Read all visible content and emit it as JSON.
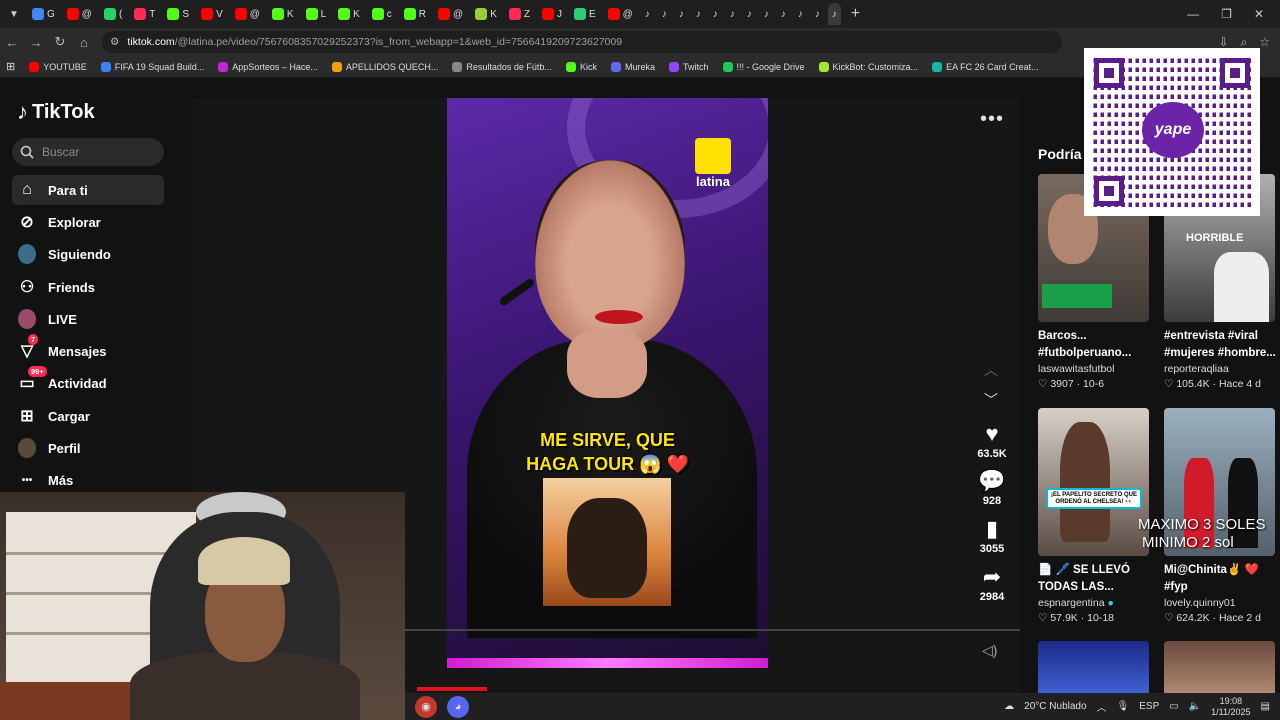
{
  "browser": {
    "tabs": [
      {
        "label": "G",
        "color": "#4285f4"
      },
      {
        "label": "@",
        "color": "#ff0000"
      },
      {
        "label": "(",
        "color": "#25d366"
      },
      {
        "label": "T",
        "color": "#fe2c55"
      },
      {
        "label": "S",
        "color": "#53fc18"
      },
      {
        "label": "V",
        "color": "#ff0000"
      },
      {
        "label": "@",
        "color": "#ff0000"
      },
      {
        "label": "K",
        "color": "#53fc18"
      },
      {
        "label": "L",
        "color": "#53fc18"
      },
      {
        "label": "K",
        "color": "#53fc18"
      },
      {
        "label": "c",
        "color": "#53fc18"
      },
      {
        "label": "R",
        "color": "#53fc18"
      },
      {
        "label": "@",
        "color": "#ff0000"
      },
      {
        "label": "K",
        "color": "#9acd32"
      },
      {
        "label": "Z",
        "color": "#fe2c55"
      },
      {
        "label": "J",
        "color": "#ff0000"
      },
      {
        "label": "E",
        "color": "#2ecc71"
      },
      {
        "label": "@",
        "color": "#ff0000"
      }
    ],
    "new_tab": "+",
    "url_host": "tiktok.com",
    "url_path": "/@latina.pe/video/7567608357029252373?is_from_webapp=1&web_id=7566419209723627009",
    "bookmarks": [
      {
        "label": "YOUTUBE",
        "color": "#ff0000"
      },
      {
        "label": "FIFA 19 Squad Build...",
        "color": "#3b82f6"
      },
      {
        "label": "AppSorteos – Hace...",
        "color": "#c026d3"
      },
      {
        "label": "APELLIDOS QUECH...",
        "color": "#f59e0b"
      },
      {
        "label": "Resultados de Fútb...",
        "color": "#888888"
      },
      {
        "label": "Kick",
        "color": "#53fc18"
      },
      {
        "label": "Mureka",
        "color": "#6366f1"
      },
      {
        "label": "Twitch",
        "color": "#9146ff"
      },
      {
        "label": "!!! - Google Drive",
        "color": "#22c55e"
      },
      {
        "label": "KickBot: Customiza...",
        "color": "#a3e635"
      },
      {
        "label": "EA FC 26 Card Creat...",
        "color": "#14b8a6"
      }
    ]
  },
  "sidebar": {
    "logo": "TikTok",
    "search_placeholder": "Buscar",
    "items": [
      {
        "label": "Para ti",
        "icon": "home-icon",
        "active": true
      },
      {
        "label": "Explorar",
        "icon": "compass-icon"
      },
      {
        "label": "Siguiendo",
        "icon": "avatar-icon"
      },
      {
        "label": "Friends",
        "icon": "friends-icon"
      },
      {
        "label": "LIVE",
        "icon": "live-avatar-icon"
      },
      {
        "label": "Mensajes",
        "icon": "send-icon",
        "badge": "7"
      },
      {
        "label": "Actividad",
        "icon": "inbox-icon",
        "badge": "99+"
      },
      {
        "label": "Cargar",
        "icon": "upload-icon"
      },
      {
        "label": "Perfil",
        "icon": "profile-avatar-icon"
      },
      {
        "label": "Más",
        "icon": "more-icon"
      }
    ]
  },
  "video": {
    "channel_logo": "latina",
    "caption_line1": "ME SIRVE, QUE",
    "caption_line2": "HAGA TOUR 😱 ❤️",
    "likes": "63.5K",
    "comments": "928",
    "saves": "3055",
    "shares": "2984"
  },
  "suggestions": {
    "heading": "Podría",
    "cards": [
      {
        "title": "Barcos...",
        "title2": "#futbolperuano...",
        "user": "laswawitasfutbol",
        "likes": "3907",
        "date": "10-6",
        "overlay": "",
        "verified": false
      },
      {
        "title": "#entrevista #viral",
        "title2": "#mujeres #hombre...",
        "user": "reporteraqliaa",
        "likes": "105.4K",
        "date": "Hace 4 d",
        "overlay": "HORRIBLE",
        "verified": false
      },
      {
        "title": "📄 🖊️ SE LLEVÓ",
        "title2": "TODAS LAS...",
        "user": "espnargentina",
        "likes": "57.9K",
        "date": "10-18",
        "overlay": "¡EL PAPELITO SECRETO QUE ORDENÓ AL CHELSEA! 👀",
        "verified": true
      },
      {
        "title": "Mi@Chinita✌️ ❤️",
        "title2": "#fyp",
        "user": "lovely.quinny01",
        "likes": "624.2K",
        "date": "Hace 2 d",
        "overlay": "",
        "verified": false
      }
    ]
  },
  "stream_overlay": {
    "qr_brand": "yape",
    "donation_line1": "MAXIMO 3 SOLES",
    "donation_line2": "MINIMO 2 sol"
  },
  "taskbar": {
    "weather": "20°C  Nublado",
    "lang": "ESP",
    "time": "19:08",
    "date": "1/11/2025"
  }
}
